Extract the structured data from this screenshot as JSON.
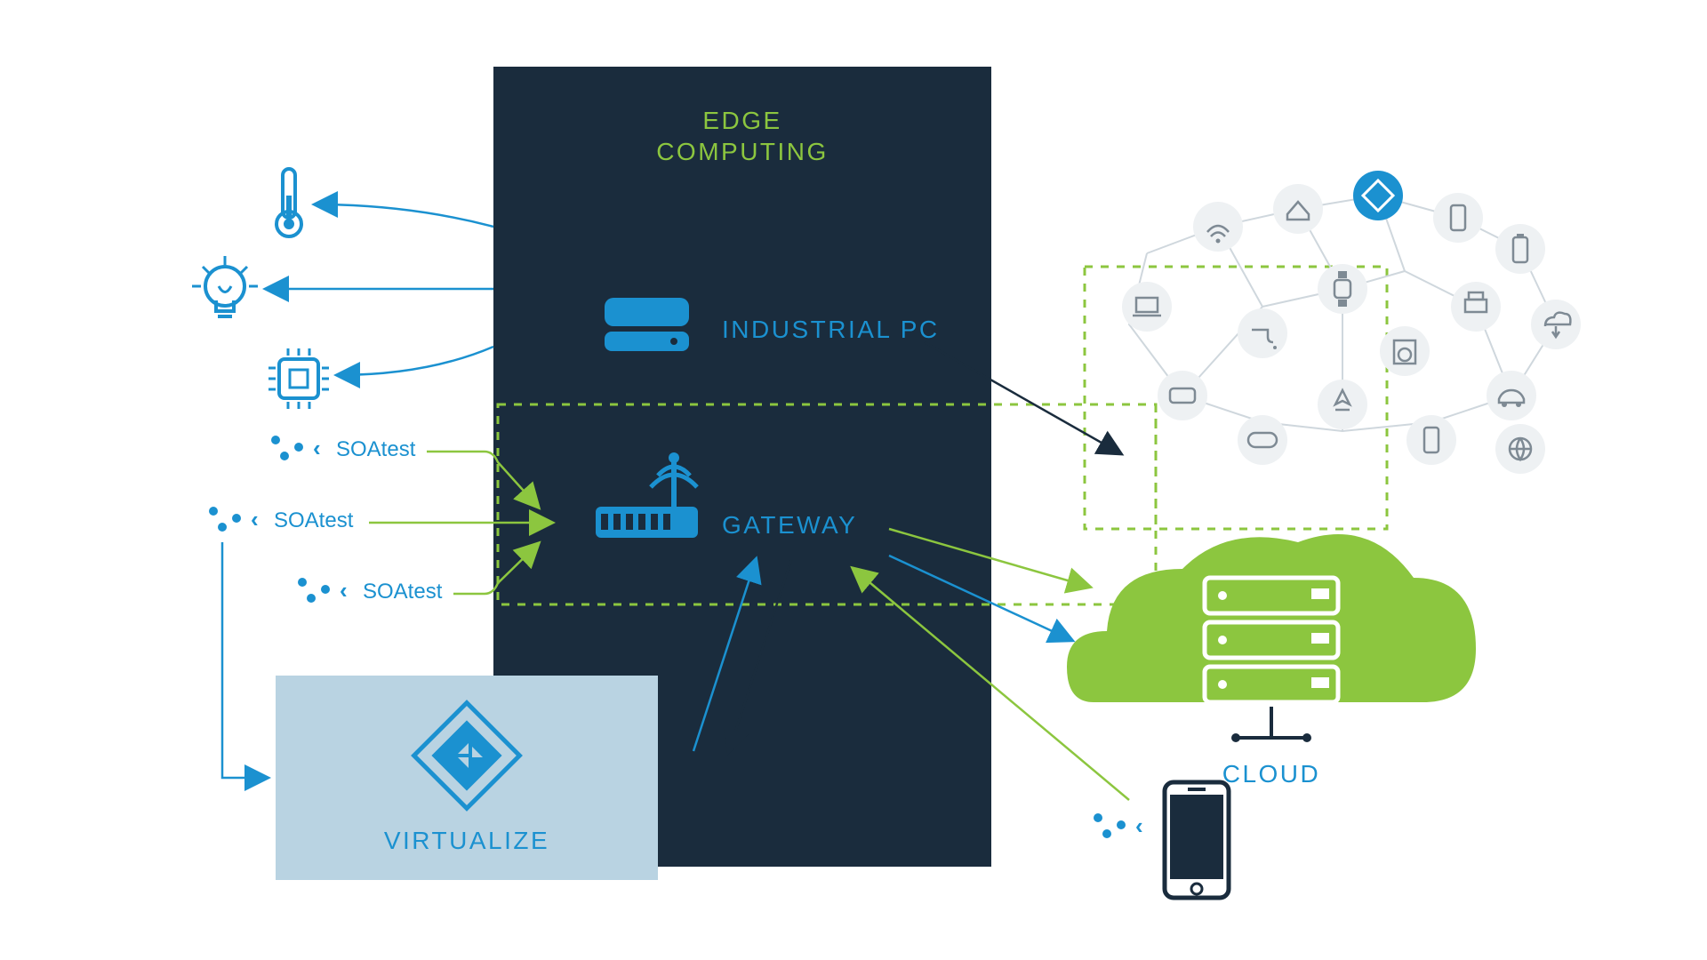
{
  "colors": {
    "navy": "#1a2c3d",
    "green": "#8cc63f",
    "greenDash": "#8cc63f",
    "blue": "#1b91d0",
    "lightBlue": "#b9d3e2",
    "grey": "#cfd7dd"
  },
  "edge": {
    "title_line1": "EDGE",
    "title_line2": "COMPUTING",
    "industrial": "INDUSTRIAL PC",
    "gateway": "GATEWAY"
  },
  "left": {
    "soatest": "SOAtest"
  },
  "virtualize": {
    "label": "VIRTUALIZE"
  },
  "cloud": {
    "label": "CLOUD"
  }
}
